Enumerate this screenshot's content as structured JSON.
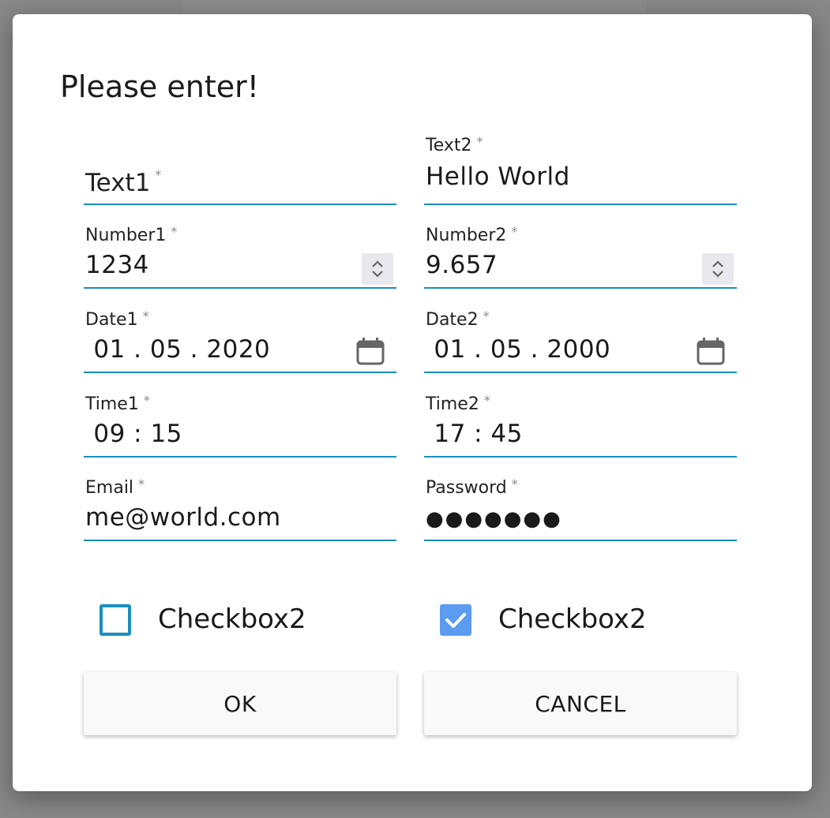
{
  "dialog": {
    "title": "Please enter!",
    "fields": {
      "text1": {
        "label": "Text1",
        "required": "*",
        "value": ""
      },
      "text2": {
        "label": "Text2",
        "required": "*",
        "value": "Hello World"
      },
      "number1": {
        "label": "Number1",
        "required": "*",
        "value": "1234"
      },
      "number2": {
        "label": "Number2",
        "required": "*",
        "value": "9.657"
      },
      "date1": {
        "label": "Date1",
        "required": "*",
        "value": " 01 . 05 . 2020"
      },
      "date2": {
        "label": "Date2",
        "required": "*",
        "value": " 01 . 05 . 2000"
      },
      "time1": {
        "label": "Time1",
        "required": "*",
        "value": " 09 : 15"
      },
      "time2": {
        "label": "Time2",
        "required": "*",
        "value": " 17 : 45"
      },
      "email": {
        "label": "Email",
        "required": "*",
        "value": "me@world.com"
      },
      "password": {
        "label": "Password",
        "required": "*",
        "value": "●●●●●●●"
      }
    },
    "checkboxes": [
      {
        "label": "Checkbox2",
        "checked": false
      },
      {
        "label": "Checkbox2",
        "checked": true
      }
    ],
    "buttons": {
      "ok": "OK",
      "cancel": "CANCEL"
    }
  },
  "colors": {
    "accent": "#1a8fc0",
    "checkbox_checked": "#5b9cf0",
    "backdrop": "#888888"
  },
  "icons": {
    "spinner": "spinner-icon",
    "calendar": "calendar-icon",
    "checkmark": "check-icon"
  }
}
